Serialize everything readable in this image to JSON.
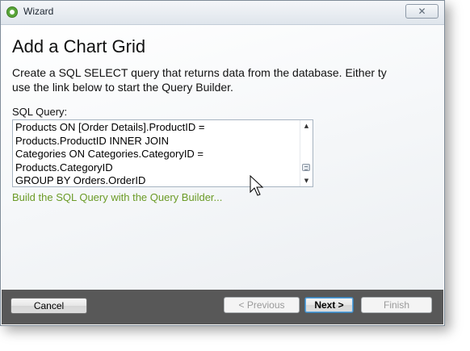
{
  "window": {
    "title": "Wizard",
    "close_glyph": "✕",
    "app_icon": "wizard-app-icon"
  },
  "page": {
    "title": "Add a Chart Grid",
    "description_line1": "Create a SQL SELECT query that returns data from the database. Either ty",
    "description_line2": "use the link below to start the Query Builder."
  },
  "sql": {
    "label": "SQL Query:",
    "value": "Products ON [Order Details].ProductID =\nProducts.ProductID INNER JOIN\nCategories ON Categories.CategoryID =\nProducts.CategoryID\nGROUP BY Orders.OrderID"
  },
  "link": {
    "query_builder": "Build the SQL Query with the Query Builder..."
  },
  "buttons": {
    "cancel": "Cancel",
    "previous": "< Previous",
    "next": "Next >",
    "finish": "Finish"
  },
  "colors": {
    "link": "#6b9b26",
    "footer": "#585858",
    "default_button_border": "#3c7fb1"
  }
}
